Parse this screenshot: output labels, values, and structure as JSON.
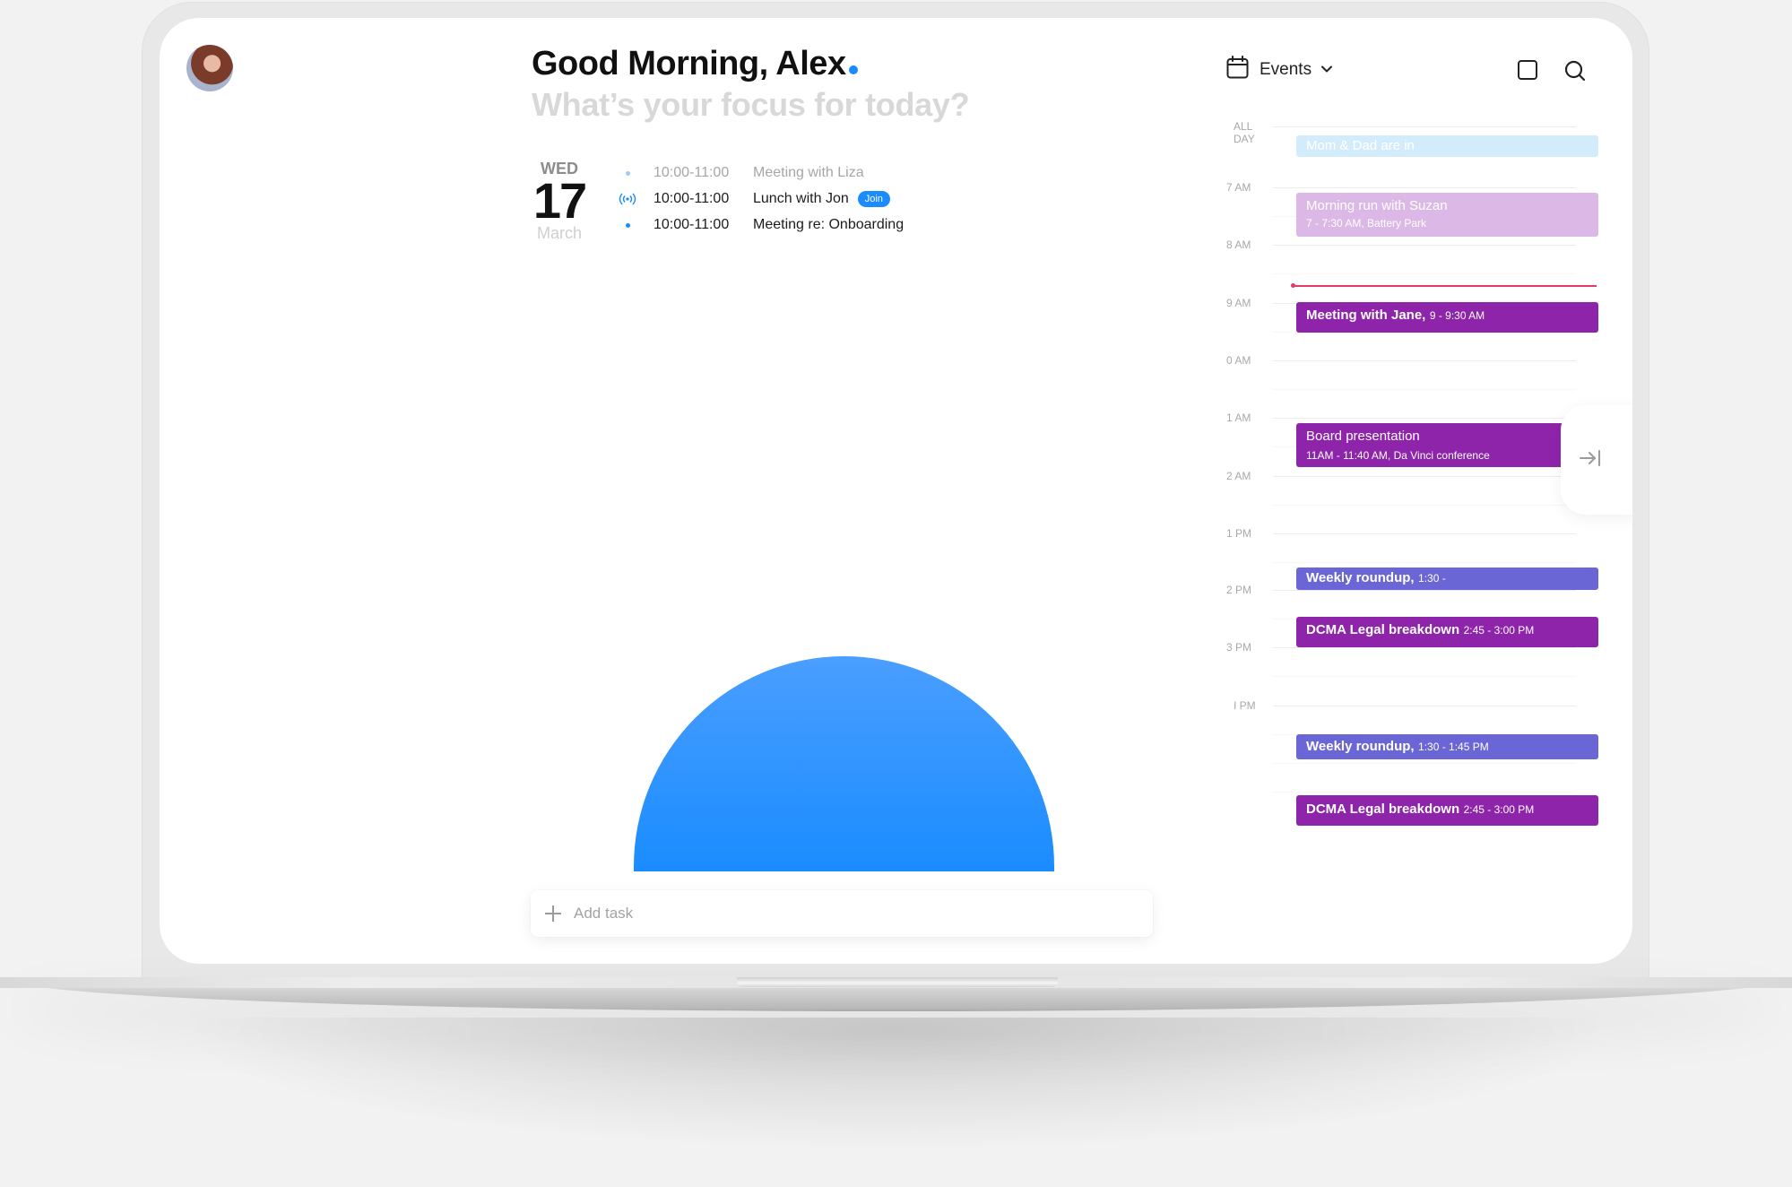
{
  "greeting": {
    "title": "Good Morning, Alex",
    "subtitle": "What’s your focus for today?",
    "accent_color": "#1a8cff"
  },
  "date": {
    "day_of_week": "WED",
    "day": "17",
    "month": "March"
  },
  "agenda": [
    {
      "marker": "dot-light",
      "time": "10:00-11:00",
      "title": "Meeting with Liza",
      "dimmed": true
    },
    {
      "marker": "live-broadcast-icon",
      "time": "10:00-11:00",
      "title": "Lunch with Jon",
      "badge": "Join",
      "dimmed": false
    },
    {
      "marker": "dot",
      "time": "10:00-11:00",
      "title": "Meeting re: Onboarding",
      "dimmed": false
    }
  ],
  "events_panel": {
    "selector_label": "Events",
    "selector_icon": "calendar-icon",
    "toggle_icon": "square-icon",
    "search_icon": "search-icon",
    "collapse_icon": "arrow-right-to-line-icon"
  },
  "timeline": {
    "labels": [
      {
        "text": "ALL DAY"
      },
      {
        "text": "7 AM"
      },
      {
        "text": "8 AM"
      },
      {
        "text": "9 AM"
      },
      {
        "text": "0 AM"
      },
      {
        "text": "1 AM"
      },
      {
        "text": "2 AM"
      },
      {
        "text": "1 PM"
      },
      {
        "text": "2 PM"
      },
      {
        "text": "3 PM"
      },
      {
        "text": "I PM"
      }
    ],
    "events": [
      {
        "title": "Mom & Dad are in",
        "time": "",
        "sub": "",
        "color": "#d3ecfb",
        "text_color": "#ffffff",
        "all_day": true
      },
      {
        "title": "Morning run with Suzan",
        "time": "",
        "sub": "7 - 7:30 AM, Battery Park",
        "color": "#dbb8e6",
        "text_color": "#ffffff"
      },
      {
        "title": "Meeting with Jane,",
        "time": "9 - 9:30 AM",
        "sub": "",
        "color": "#8e24aa",
        "text_color": "#ffffff"
      },
      {
        "title": "Board presentation",
        "time": "",
        "sub": "11AM - 11:40 AM, Da Vinci conference",
        "color": "#8e24aa",
        "text_color": "#ffffff"
      },
      {
        "title": "Weekly roundup,",
        "time": "1:30 -",
        "sub": "",
        "color": "#6b66d6",
        "text_color": "#ffffff"
      },
      {
        "title": "DCMA Legal breakdown",
        "time": "2:45 - 3:00 PM",
        "sub": "",
        "color": "#8e24aa",
        "text_color": "#ffffff"
      },
      {
        "title": "Weekly roundup,",
        "time": "1:30 - 1:45 PM",
        "sub": "",
        "color": "#6b66d6",
        "text_color": "#ffffff"
      },
      {
        "title": "DCMA Legal breakdown",
        "time": "2:45 - 3:00 PM",
        "sub": "",
        "color": "#8e24aa",
        "text_color": "#ffffff"
      }
    ],
    "now_indicator_color": "#e8386a"
  },
  "add_task": {
    "placeholder": "Add task",
    "value": ""
  }
}
